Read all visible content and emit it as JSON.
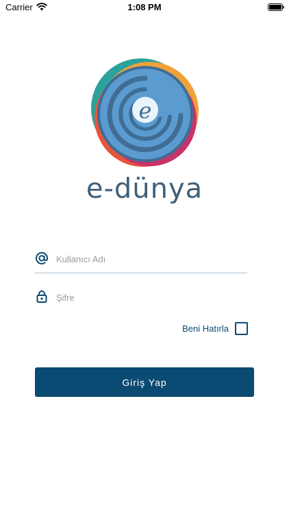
{
  "status_bar": {
    "carrier": "Carrier",
    "time": "1:08 PM"
  },
  "brand": {
    "name": "e-dünya",
    "logo_letter": "e"
  },
  "login_form": {
    "username_placeholder": "Kullanıcı Adı",
    "password_placeholder": "Şifre",
    "remember_label": "Beni Hatırla",
    "remember_checked": false,
    "submit_label": "Giriş Yap"
  },
  "colors": {
    "primary": "#0b4a72",
    "logo_teal": "#2ba39b",
    "logo_orange": "#f0a13a",
    "logo_red": "#e8553a",
    "logo_magenta": "#c8336b",
    "logo_blue_dark": "#3f5f78",
    "logo_blue_light": "#6aaee0"
  },
  "icons": {
    "wifi": "wifi-icon",
    "battery": "battery-icon",
    "at": "at-sign-icon",
    "lock": "lock-icon"
  }
}
